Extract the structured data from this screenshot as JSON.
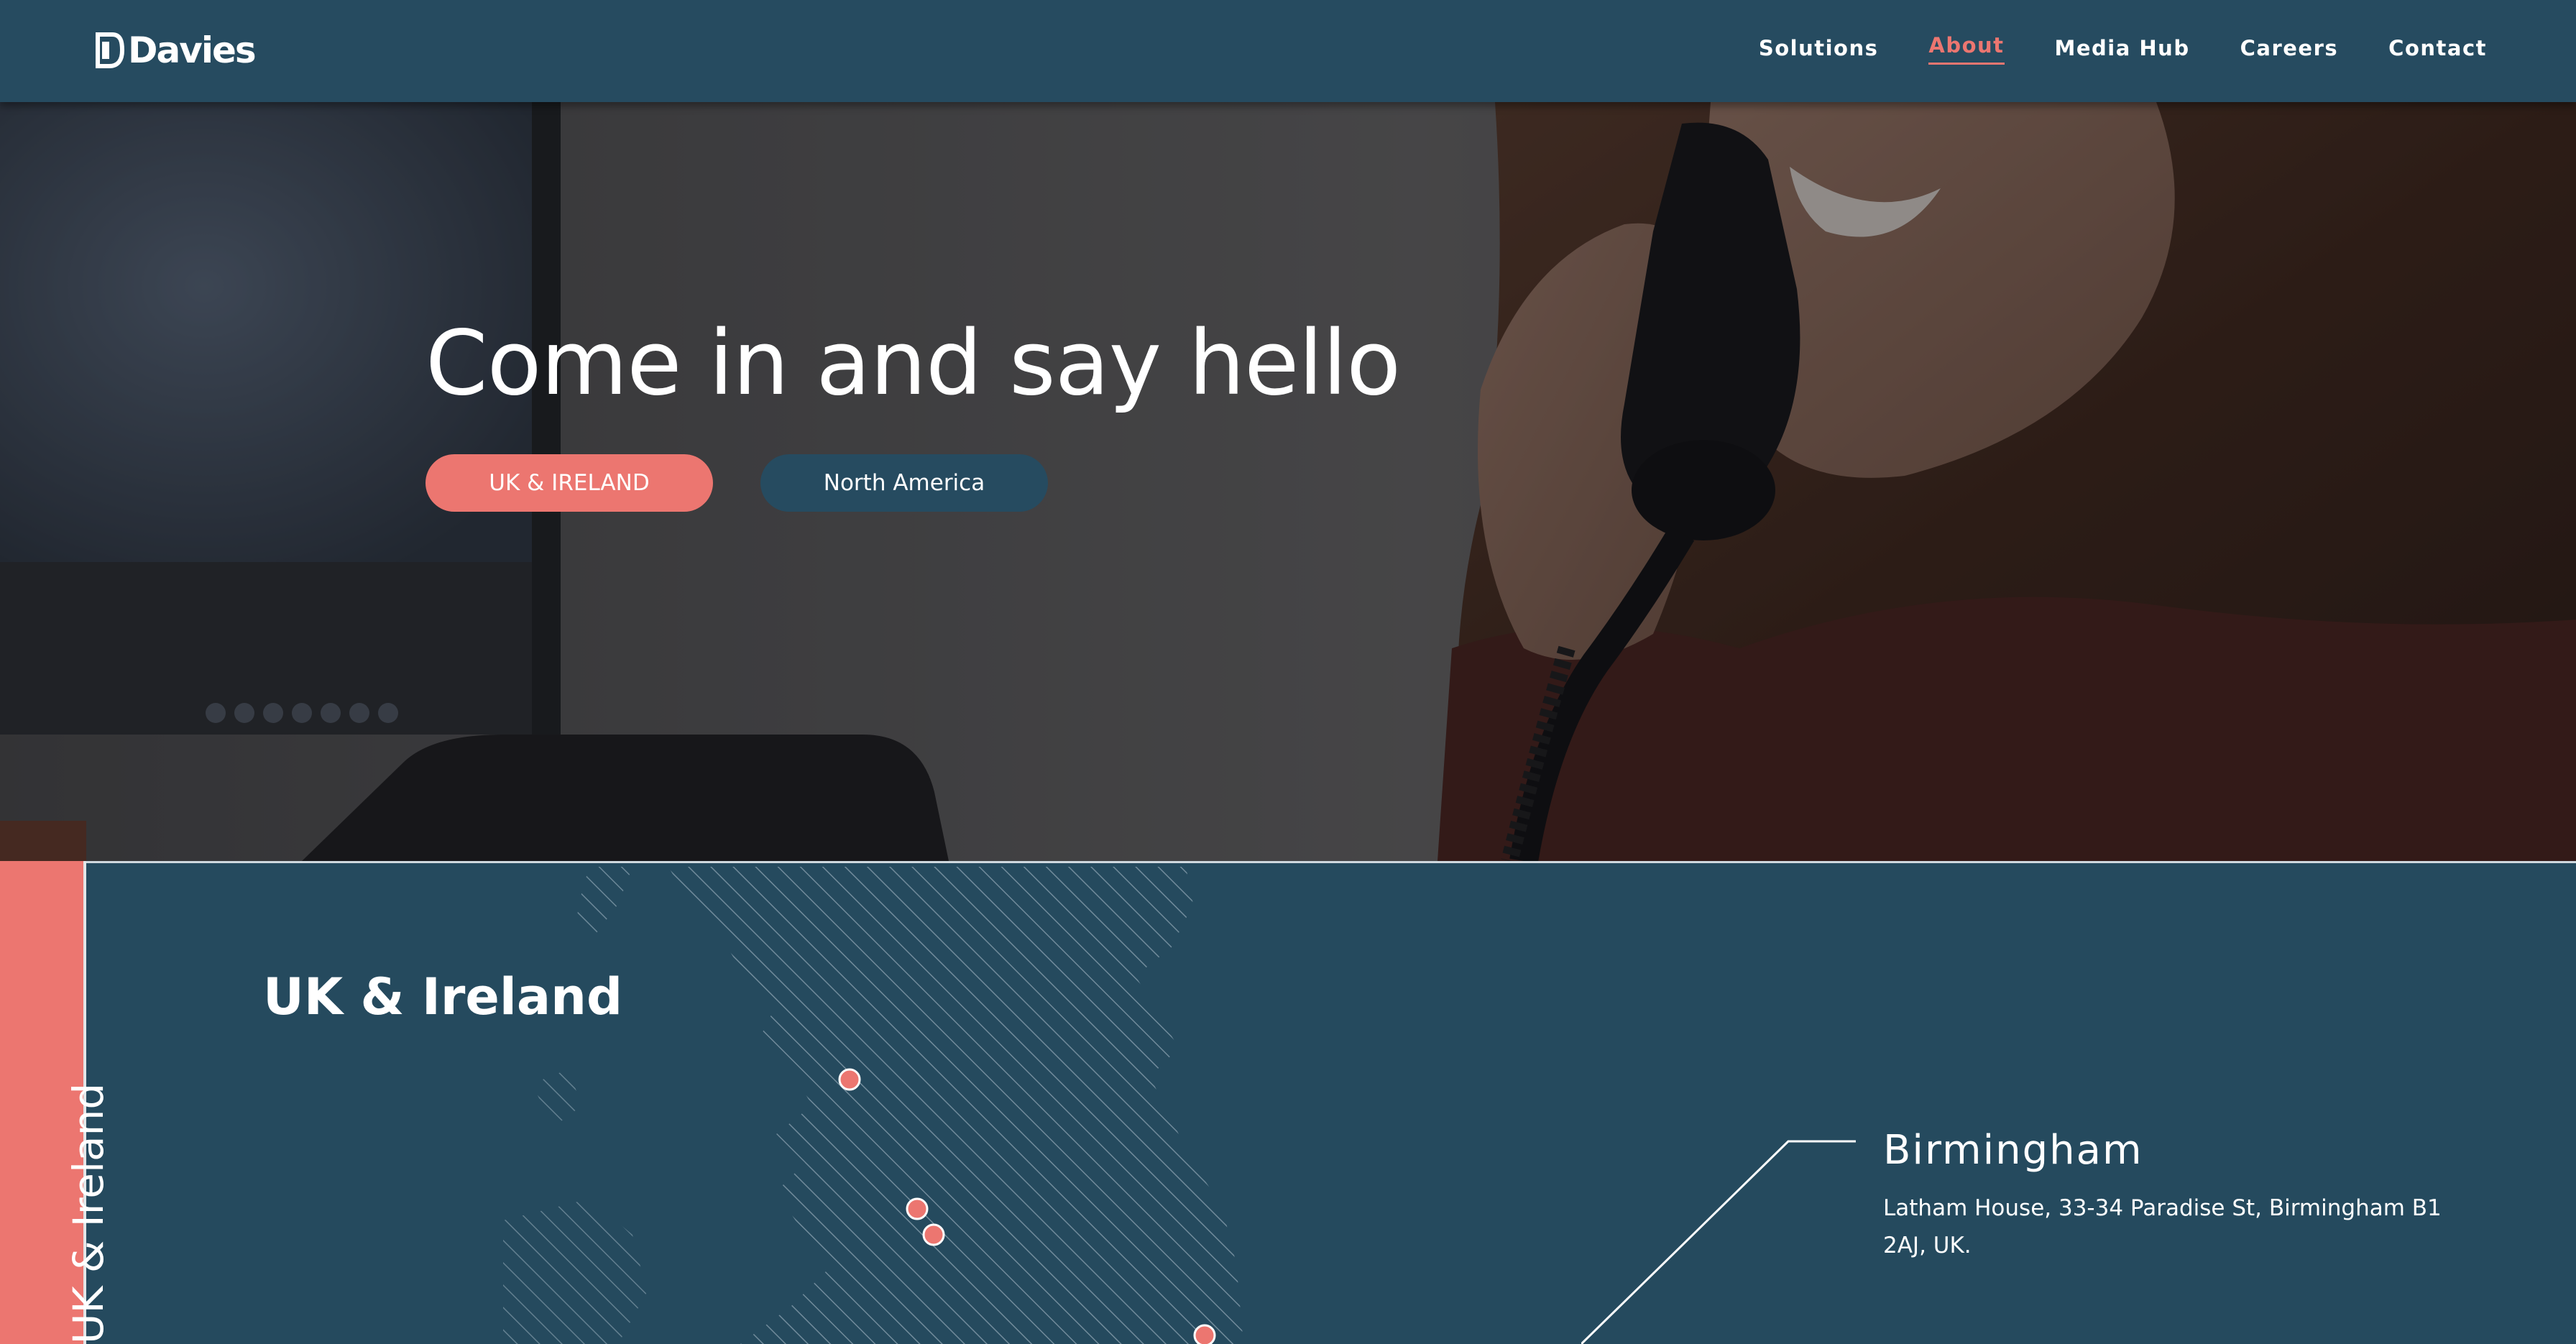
{
  "brand": {
    "name": "Davies"
  },
  "nav": {
    "items": [
      {
        "label": "Solutions"
      },
      {
        "label": "About"
      },
      {
        "label": "Media Hub"
      },
      {
        "label": "Careers"
      },
      {
        "label": "Contact"
      }
    ],
    "active": "About"
  },
  "hero": {
    "title": "Come in and say hello",
    "buttons": {
      "uk": "UK & IRELAND",
      "na": "North America"
    }
  },
  "region": {
    "side_tab_label": "UK & Ireland",
    "title": "UK & Ireland",
    "office": {
      "city": "Birmingham",
      "address": "Latham House, 33-34 Paradise St, Birmingham B1 2AJ, UK."
    }
  },
  "colors": {
    "navy": "#264b60",
    "coral": "#ec7670",
    "white": "#ffffff"
  }
}
